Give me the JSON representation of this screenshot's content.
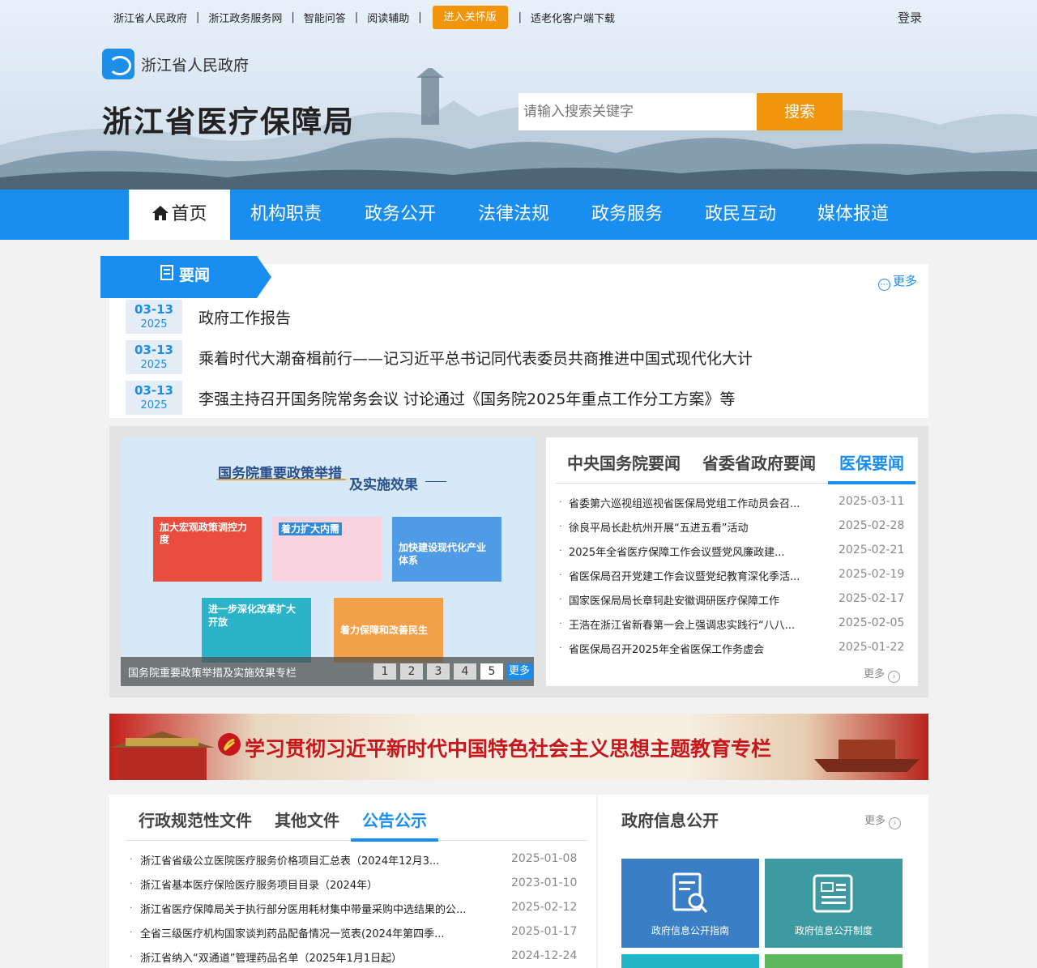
{
  "topbar": {
    "links": [
      "浙江省人民政府",
      "浙江政务服务网",
      "智能问答",
      "阅读辅助"
    ],
    "care_button": "进入关怀版",
    "app_download": "适老化客户端下载",
    "login": "登录"
  },
  "header": {
    "logo_text": "浙江省人民政府",
    "site_title": "浙江省医疗保障局",
    "search_placeholder": "请输入搜索关键字",
    "search_button": "搜索"
  },
  "nav": [
    "首页",
    "机构职责",
    "政务公开",
    "法律法规",
    "政务服务",
    "政民互动",
    "媒体报道"
  ],
  "news": {
    "label": "要闻",
    "more": "更多",
    "items": [
      {
        "md": "03-13",
        "year": "2025",
        "title": "政府工作报告"
      },
      {
        "md": "03-13",
        "year": "2025",
        "title": "乘着时代大潮奋楫前行——记习近平总书记同代表委员共商推进中国式现代化大计"
      },
      {
        "md": "03-13",
        "year": "2025",
        "title": "李强主持召开国务院常务会议 讨论通过《国务院2025年重点工作分工方案》等"
      }
    ]
  },
  "carousel": {
    "title_line1": "国务院重要政策举措",
    "title_line2": "及实施效果",
    "cards": [
      "加大宏观政策调控力度",
      "着力扩大内需",
      "加快建设现代化产业体系",
      "进一步深化改革扩大开放",
      "着力保障和改善民生"
    ],
    "caption": "国务院重要政策举措及实施效果专栏",
    "pages": [
      "1",
      "2",
      "3",
      "4",
      "5"
    ],
    "active_page": "5",
    "more": "更多"
  },
  "tabs": {
    "labels": [
      "中央国务院要闻",
      "省委省政府要闻",
      "医保要闻"
    ],
    "active": "医保要闻",
    "items": [
      {
        "title": "省委第六巡视组巡视省医保局党组工作动员会召...",
        "date": "2025-03-11"
      },
      {
        "title": "徐良平局长赴杭州开展“五进五看”活动",
        "date": "2025-02-28"
      },
      {
        "title": "2025年全省医疗保障工作会议暨党风廉政建...",
        "date": "2025-02-21"
      },
      {
        "title": "省医保局召开党建工作会议暨党纪教育深化季活...",
        "date": "2025-02-19"
      },
      {
        "title": "国家医保局局长章轲赴安徽调研医疗保障工作",
        "date": "2025-02-17"
      },
      {
        "title": "王浩在浙江省新春第一会上强调忠实践行“八八...",
        "date": "2025-02-05"
      },
      {
        "title": "省医保局召开2025年全省医保工作务虚会",
        "date": "2025-01-22"
      }
    ],
    "more": "更多"
  },
  "banner": {
    "text": "学习贯彻习近平新时代中国特色社会主义思想主题教育专栏"
  },
  "docs": {
    "labels": [
      "行政规范性文件",
      "其他文件",
      "公告公示"
    ],
    "active": "公告公示",
    "items": [
      {
        "title": "浙江省省级公立医院医疗服务价格项目汇总表（2024年12月3...",
        "date": "2025-01-08"
      },
      {
        "title": "浙江省基本医疗保险医疗服务项目目录（2024年）",
        "date": "2023-01-10"
      },
      {
        "title": "浙江省医疗保障局关于执行部分医用耗材集中带量采购中选结果的公...",
        "date": "2025-02-12"
      },
      {
        "title": "全省三级医疗机构国家谈判药品配备情况一览表(2024年第四季...",
        "date": "2025-01-17"
      },
      {
        "title": "浙江省纳入“双通道”管理药品名单（2025年1月1日起）",
        "date": "2024-12-24"
      }
    ]
  },
  "gov_info": {
    "title": "政府信息公开",
    "more": "更多",
    "tiles": [
      "政府信息公开指南",
      "政府信息公开制度"
    ],
    "colors": [
      "#3a7fc6",
      "#3d9aa2",
      "#22b6c9",
      "#5cb85c"
    ]
  },
  "colors": {
    "accent": "#1a8df0",
    "orange": "#f1960c",
    "red": "#c8161d"
  }
}
